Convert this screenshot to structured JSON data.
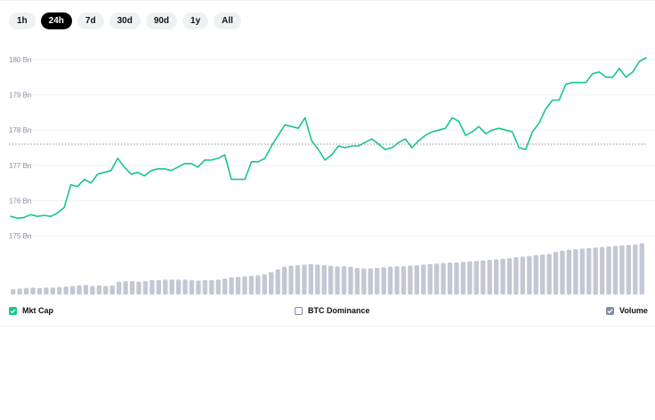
{
  "time_tabs": [
    {
      "label": "1h",
      "active": false
    },
    {
      "label": "24h",
      "active": true
    },
    {
      "label": "7d",
      "active": false
    },
    {
      "label": "30d",
      "active": false
    },
    {
      "label": "90d",
      "active": false
    },
    {
      "label": "1y",
      "active": false
    },
    {
      "label": "All",
      "active": false
    }
  ],
  "legend": {
    "mkt_cap": {
      "label": "Mkt Cap",
      "checked": true
    },
    "btc_dominance": {
      "label": "BTC Dominance",
      "checked": false
    },
    "volume": {
      "label": "Volume",
      "checked": true
    }
  },
  "colors": {
    "line": "#16c784",
    "volume": "#c4c8d4",
    "grid": "#eef0f3",
    "axis_text": "#8a91a5",
    "reference_line": "#8f8f8f"
  },
  "chart_data": {
    "type": "line",
    "ylim": [
      175,
      180
    ],
    "y_tick_labels": [
      "180 Bn",
      "179 Bn",
      "178 Bn",
      "177 Bn",
      "176 Bn",
      "175 Bn"
    ],
    "y_tick_values": [
      180,
      179,
      178,
      177,
      176,
      175
    ],
    "reference_value": 177.6,
    "series": [
      {
        "values": [
          175.55,
          175.5,
          175.52,
          175.6,
          175.55,
          175.58,
          175.55,
          175.65,
          175.8,
          176.45,
          176.4,
          176.6,
          176.5,
          176.75,
          176.8,
          176.85,
          177.2,
          176.95,
          176.75,
          176.8,
          176.7,
          176.85,
          176.9,
          176.9,
          176.85,
          176.95,
          177.05,
          177.05,
          176.95,
          177.15,
          177.15,
          177.2,
          177.3,
          176.6,
          176.6,
          176.6,
          177.1,
          177.1,
          177.2,
          177.55,
          177.85,
          178.15,
          178.1,
          178.05,
          178.35,
          177.7,
          177.45,
          177.15,
          177.3,
          177.55,
          177.5,
          177.55,
          177.55,
          177.65,
          177.75,
          177.6,
          177.45,
          177.5,
          177.65,
          177.75,
          177.5,
          177.7,
          177.85,
          177.95,
          178.0,
          178.05,
          178.35,
          178.25,
          177.85,
          177.95,
          178.1,
          177.9,
          178.0,
          178.05,
          178.0,
          177.95,
          177.5,
          177.45,
          177.95,
          178.2,
          178.6,
          178.85,
          178.85,
          179.3,
          179.35,
          179.35,
          179.35,
          179.6,
          179.65,
          179.5,
          179.5,
          179.75,
          179.5,
          179.65,
          179.95,
          180.05
        ]
      }
    ],
    "volume_values": [
      0.1,
      0.11,
      0.12,
      0.13,
      0.12,
      0.13,
      0.13,
      0.14,
      0.15,
      0.16,
      0.17,
      0.18,
      0.16,
      0.17,
      0.16,
      0.17,
      0.24,
      0.25,
      0.25,
      0.24,
      0.25,
      0.27,
      0.27,
      0.28,
      0.28,
      0.28,
      0.28,
      0.27,
      0.26,
      0.27,
      0.27,
      0.28,
      0.3,
      0.32,
      0.33,
      0.34,
      0.35,
      0.36,
      0.38,
      0.42,
      0.47,
      0.52,
      0.54,
      0.55,
      0.56,
      0.57,
      0.56,
      0.55,
      0.54,
      0.53,
      0.53,
      0.52,
      0.5,
      0.49,
      0.49,
      0.5,
      0.51,
      0.52,
      0.53,
      0.53,
      0.54,
      0.55,
      0.56,
      0.57,
      0.58,
      0.59,
      0.6,
      0.6,
      0.61,
      0.62,
      0.63,
      0.64,
      0.65,
      0.66,
      0.67,
      0.68,
      0.7,
      0.71,
      0.72,
      0.74,
      0.75,
      0.76,
      0.8,
      0.82,
      0.84,
      0.85,
      0.86,
      0.87,
      0.88,
      0.89,
      0.9,
      0.91,
      0.92,
      0.93,
      0.94,
      0.96
    ]
  }
}
